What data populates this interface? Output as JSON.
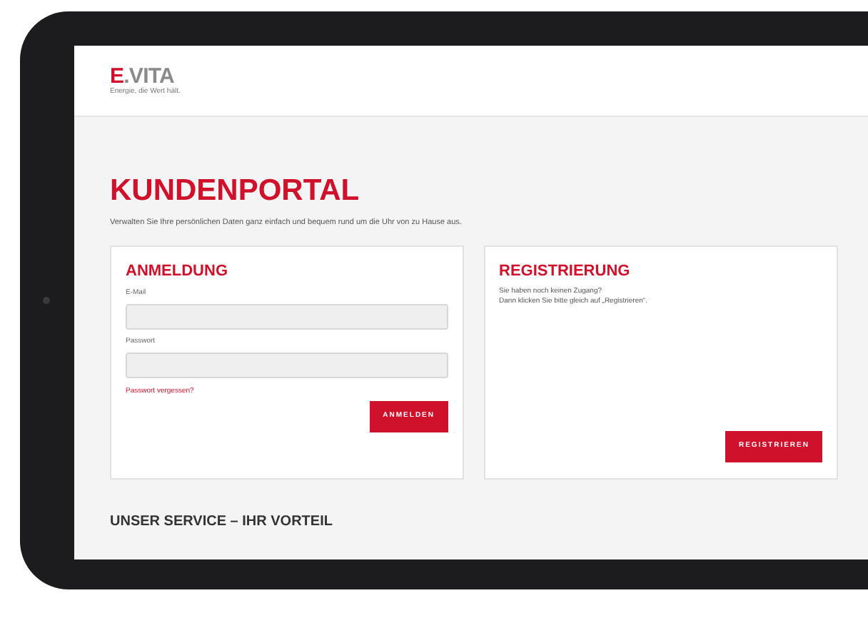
{
  "header": {
    "logo": "E.VITA",
    "tagline": "Energie, die Wert hält."
  },
  "title": "KUNDENPORTAL",
  "intro": "Verwalten Sie Ihre persönlichen Daten ganz einfach und bequem rund um die Uhr von zu Hause aus.",
  "login": {
    "heading": "ANMELDUNG",
    "fields": [
      {
        "label": "E-Mail"
      },
      {
        "label": "Passwort"
      }
    ],
    "forgot_link": "Passwort vergessen?",
    "button": "ANMELDEN"
  },
  "registration": {
    "heading": "REGISTRIERUNG",
    "lines": [
      "Sie haben noch keinen Zugang?",
      "Dann klicken Sie bitte gleich auf „Registrieren“."
    ],
    "button": "REGISTRIEREN"
  },
  "service_heading": "UNSER SERVICE – IHR VORTEIL"
}
